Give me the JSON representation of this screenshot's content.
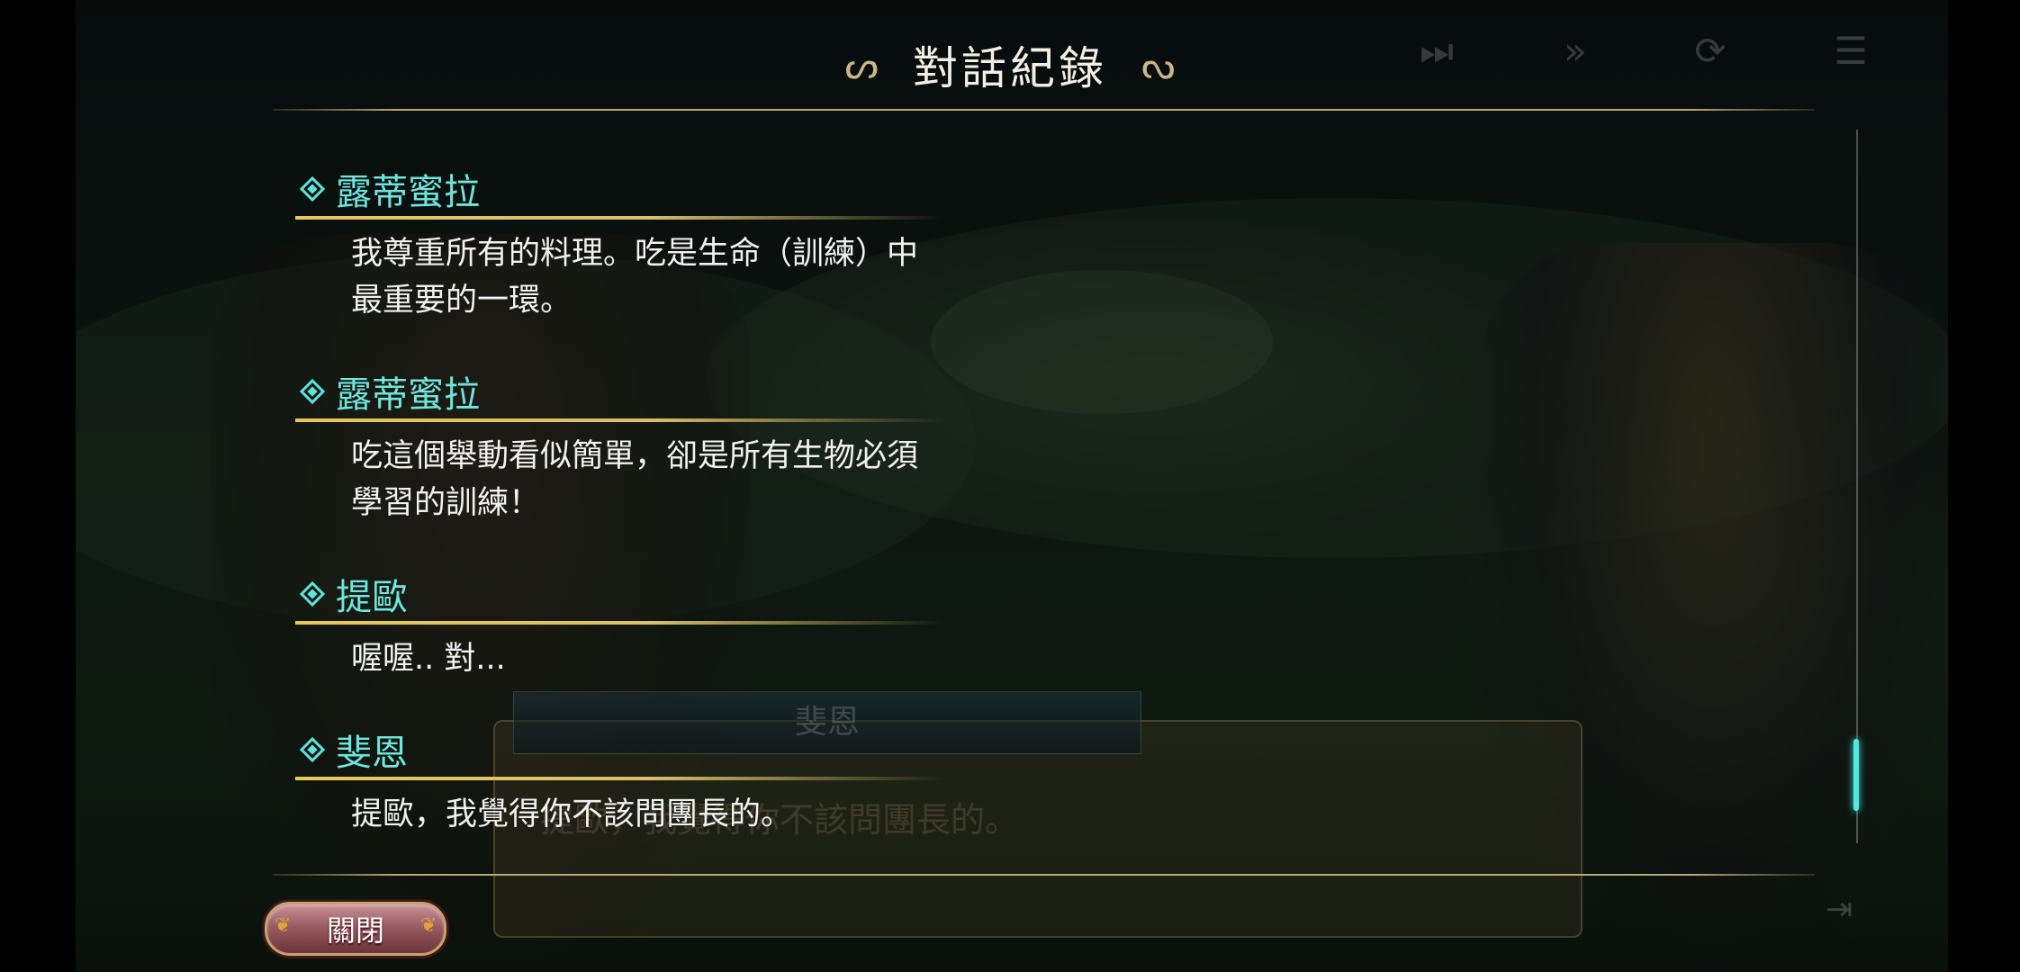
{
  "title": "對話紀錄",
  "entries": [
    {
      "speaker": "露蒂蜜拉",
      "line1": "我尊重所有的料理。吃是生命（訓練）中",
      "line2": "最重要的一環。"
    },
    {
      "speaker": "露蒂蜜拉",
      "line1": "吃這個舉動看似簡單，卻是所有生物必須",
      "line2": "學習的訓練！"
    },
    {
      "speaker": "提歐",
      "line1": "喔喔.. 對...",
      "line2": ""
    },
    {
      "speaker": "斐恩",
      "line1": "提歐，我覺得你不該問團長的。",
      "line2": ""
    }
  ],
  "close_button": "關閉",
  "background": {
    "name_plate": "斐恩",
    "dialog_text": "提歐，我覺得你不該問團長的。",
    "nav_icons": [
      "skip-to-end-icon",
      "fast-forward-icon",
      "auto-play-icon",
      "log-icon"
    ]
  },
  "scroll": {
    "position": 0.95
  },
  "colors": {
    "speaker": "#6de7de",
    "accent_line": "#e6c85c",
    "rule": "#b8a775",
    "scroll_thumb": "#4fe9e0"
  }
}
